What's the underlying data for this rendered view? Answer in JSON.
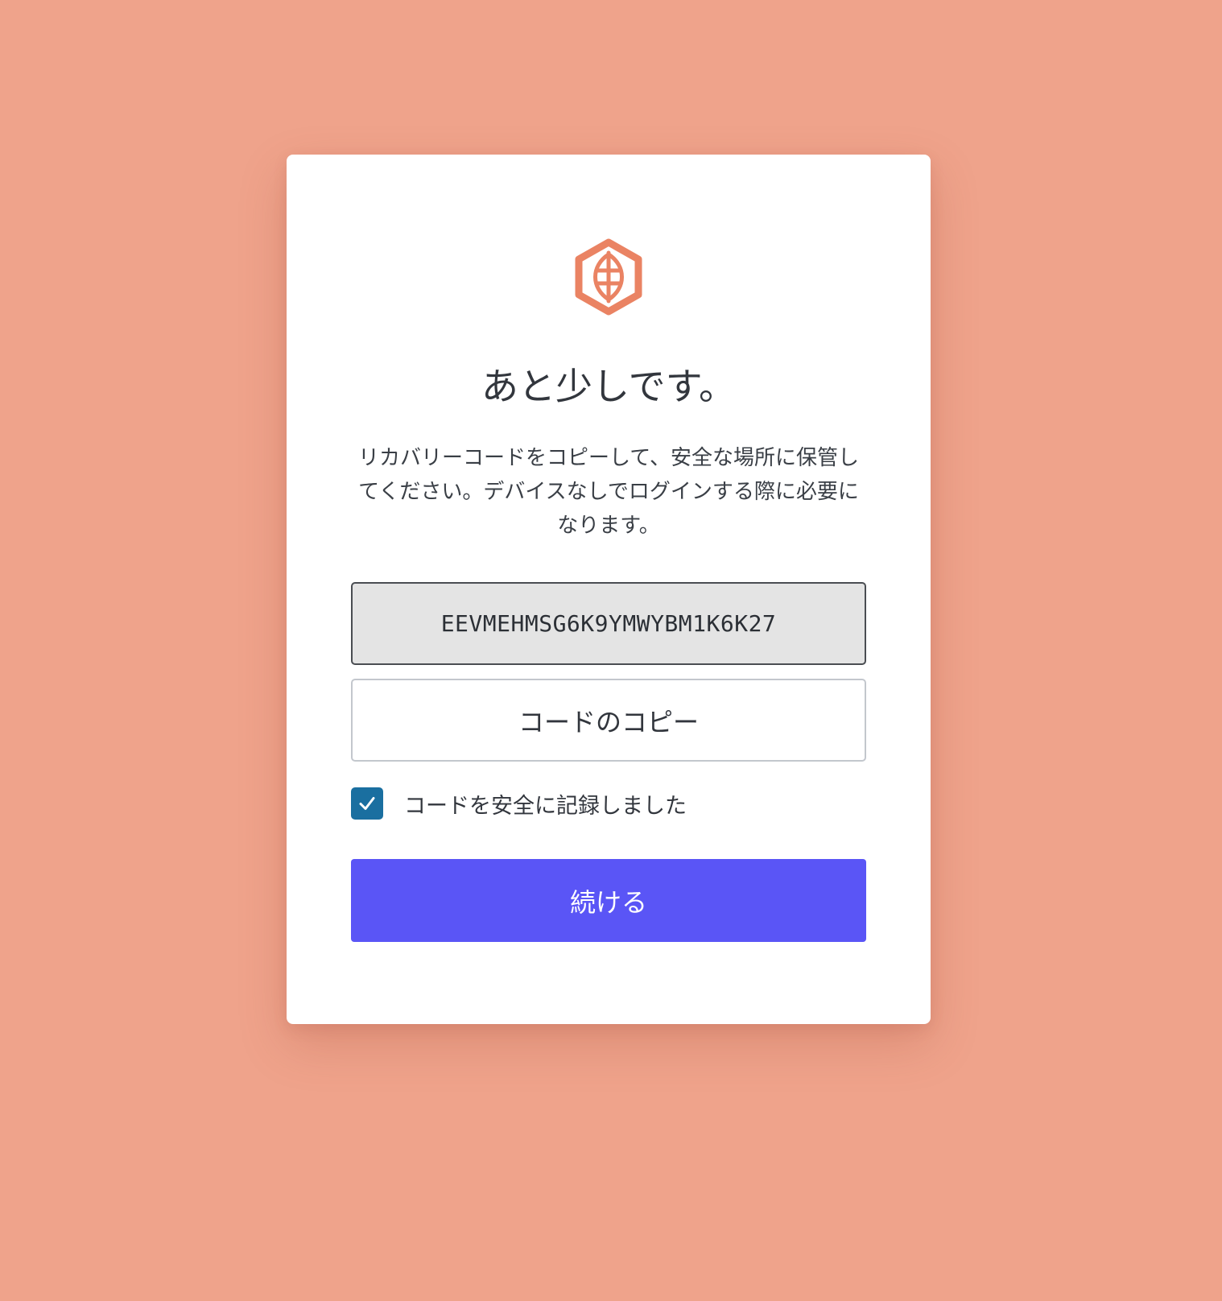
{
  "page": {
    "title": "あと少しです。",
    "description": "リカバリーコードをコピーして、安全な場所に保管してください。デバイスなしでログインする際に必要になります。"
  },
  "logo": {
    "icon": "hexagon-logo-icon",
    "color": "#ea8363"
  },
  "recovery_code": {
    "value": "EEVMEHMSG6K9YMWYBM1K6K27"
  },
  "copy_button": {
    "label": "コードのコピー"
  },
  "confirm_checkbox": {
    "label": "コードを安全に記録しました",
    "checked": true,
    "color": "#1a6fa0"
  },
  "continue_button": {
    "label": "続ける",
    "color": "#5a55f6"
  },
  "theme": {
    "background": "#efa38b",
    "card": "#ffffff"
  }
}
